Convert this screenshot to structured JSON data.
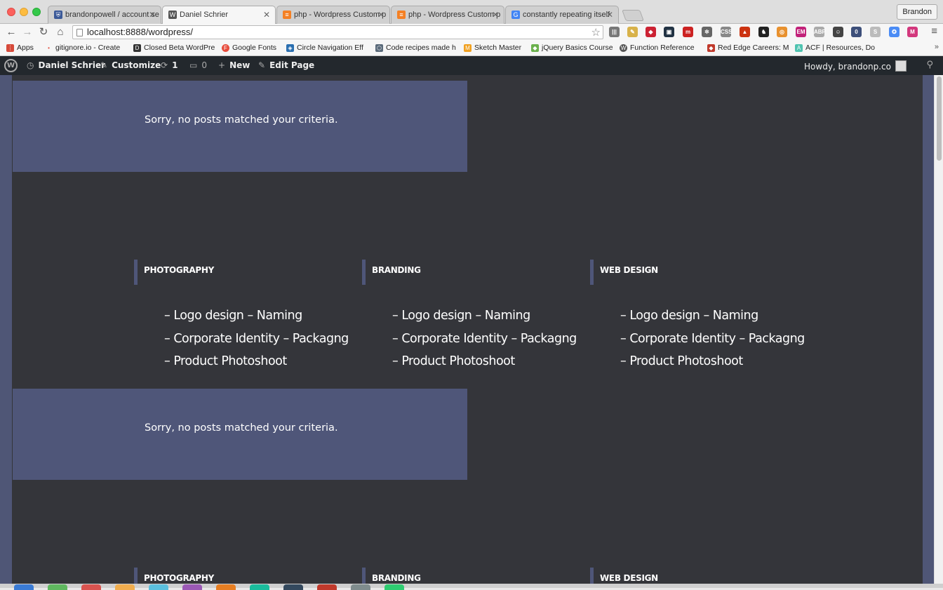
{
  "window": {
    "profile_name": "Brandon"
  },
  "tabs": [
    {
      "title": "brandonpowell / account se",
      "icon_color": "#3b5998",
      "icon_glyph": "⛨"
    },
    {
      "title": "Daniel Schrier",
      "icon_color": "#555555",
      "icon_glyph": "W"
    },
    {
      "title": "php - Wordpress Custom p",
      "icon_color": "#f48024",
      "icon_glyph": "≡"
    },
    {
      "title": "php - Wordpress Custom p",
      "icon_color": "#f48024",
      "icon_glyph": "≡"
    },
    {
      "title": "constantly repeating itself",
      "icon_color": "#4285f4",
      "icon_glyph": "G"
    }
  ],
  "toolbar": {
    "back_icon": "back-arrow-icon",
    "forward_icon": "forward-arrow-icon",
    "reload_icon": "reload-icon",
    "home_icon": "home-icon",
    "url": "localhost:8888/wordpress/",
    "extensions": [
      {
        "name": "bookmarks-ext",
        "color": "#777777",
        "glyph": "|||"
      },
      {
        "name": "notes-ext",
        "color": "#d8b24a",
        "glyph": "✎"
      },
      {
        "name": "ruby-ext",
        "color": "#cc2233",
        "glyph": "◆"
      },
      {
        "name": "dark-ext",
        "color": "#223344",
        "glyph": "▣"
      },
      {
        "name": "m-ext",
        "color": "#cc2222",
        "glyph": "m"
      },
      {
        "name": "bug-ext",
        "color": "#666666",
        "glyph": "✲"
      },
      {
        "name": "css-ext",
        "color": "#888888",
        "glyph": "CSS"
      },
      {
        "name": "arrow-ext",
        "color": "#cc3311",
        "glyph": "▲"
      },
      {
        "name": "figure-ext",
        "color": "#222222",
        "glyph": "♞"
      },
      {
        "name": "orange-ext",
        "color": "#e8912f",
        "glyph": "◎"
      },
      {
        "name": "em-ext",
        "color": "#c2227a",
        "glyph": "EM"
      },
      {
        "name": "abp-ext",
        "color": "#aaaaaa",
        "glyph": "ABP"
      },
      {
        "name": "panda-ext",
        "color": "#444444",
        "glyph": "☺"
      },
      {
        "name": "onetab-ext",
        "color": "#3d4f7a",
        "glyph": "0"
      },
      {
        "name": "s-ext",
        "color": "#bbbbbb",
        "glyph": "S"
      },
      {
        "name": "blue-ext",
        "color": "#4b8cf5",
        "glyph": "✪"
      },
      {
        "name": "script-m-ext",
        "color": "#d3387d",
        "glyph": "M"
      }
    ]
  },
  "bookmarks": [
    {
      "label": "Apps",
      "icon_color": "#d64a3a",
      "glyph": "⋮"
    },
    {
      "label": "gitignore.io - Create",
      "icon_color": "#e24a3a",
      "glyph": "•"
    },
    {
      "label": "Closed Beta WordPre",
      "icon_color": "#333333",
      "glyph": "D"
    },
    {
      "label": "Google Fonts",
      "icon_color": "#e74c3c",
      "glyph": "F"
    },
    {
      "label": "Circle Navigation Eff",
      "icon_color": "#2a6fb0",
      "glyph": "◈"
    },
    {
      "label": "Code recipes made h",
      "icon_color": "#5a6a7a",
      "glyph": "⬡"
    },
    {
      "label": "Sketch Master",
      "icon_color": "#f0a020",
      "glyph": "M"
    },
    {
      "label": "jQuery Basics Course",
      "icon_color": "#6ab04c",
      "glyph": "◆"
    },
    {
      "label": "Function Reference",
      "icon_color": "#555555",
      "glyph": "W"
    },
    {
      "label": "Red Edge Careers: M",
      "icon_color": "#c0392b",
      "glyph": "◆"
    },
    {
      "label": "ACF | Resources, Do",
      "icon_color": "#4fc3b0",
      "glyph": "A"
    }
  ],
  "adminbar": {
    "site_name": "Daniel Schrier",
    "customize": "Customize",
    "updates_count": "1",
    "comments_count": "0",
    "new_label": "New",
    "edit_label": "Edit Page",
    "howdy": "Howdy, brandonp.co"
  },
  "content": {
    "notice_text": "Sorry, no posts matched your criteria.",
    "services": [
      {
        "title": "PHOTOGRAPHY",
        "items": [
          "– Logo design – Naming",
          "– Corporate Identity – Packagng",
          "– Product Photoshoot"
        ]
      },
      {
        "title": "BRANDING",
        "items": [
          "– Logo design – Naming",
          "– Corporate Identity – Packagng",
          "– Product Photoshoot"
        ]
      },
      {
        "title": "WEB DESIGN",
        "items": [
          "– Logo design – Naming",
          "– Corporate Identity – Packagng",
          "– Product Photoshoot"
        ]
      }
    ]
  },
  "colors": {
    "page_background": "#34353a",
    "accent_block": "#4f5679",
    "admin_bar": "#23282d"
  }
}
